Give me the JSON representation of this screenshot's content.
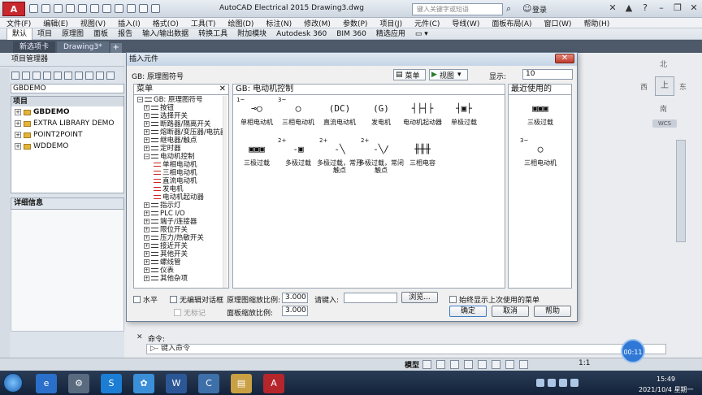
{
  "app": {
    "logo": "A",
    "title": "AutoCAD Electrical 2015    Drawing3.dwg",
    "search_placeholder": "键入关键字或短语",
    "login": "登录"
  },
  "menubar": [
    "文件(F)",
    "编辑(E)",
    "视图(V)",
    "插入(I)",
    "格式(O)",
    "工具(T)",
    "绘图(D)",
    "标注(N)",
    "修改(M)",
    "参数(P)",
    "项目(J)",
    "元件(C)",
    "导线(W)",
    "面板布局(A)",
    "窗口(W)",
    "帮助(H)"
  ],
  "ribbon_tabs": [
    "默认",
    "项目",
    "原理图",
    "面板",
    "报告",
    "输入/输出数据",
    "转换工具",
    "附加模块",
    "Autodesk 360",
    "BIM 360",
    "精选应用"
  ],
  "doc_tabs": [
    "新选项卡",
    "Drawing3*"
  ],
  "doc_tab_add": "+",
  "viewcube": {
    "n": "北",
    "w": "西",
    "top": "上",
    "e": "东",
    "s": "南",
    "wcs": "WCS"
  },
  "project_manager": {
    "title": "项目管理器",
    "active": "GBDEMO",
    "tree_head": "项目",
    "projects": [
      "GBDEMO",
      "EXTRA LIBRARY DEMO",
      "POINT2POINT",
      "WDDEMO"
    ],
    "details": "详细信息"
  },
  "command": {
    "label": "命令:",
    "prompt": "▷- 键入命令"
  },
  "status": {
    "model": "模型",
    "scale": "1:1",
    "timer": "00:11"
  },
  "taskbar": {
    "time": "15:49",
    "date": "2021/10/4 星期一"
  },
  "dialog": {
    "title": "插入元件",
    "gb_label": "GB: 原理图符号",
    "menu_btn": "菜单",
    "view_btn": "视图",
    "display_label": "显示:",
    "display_value": "10",
    "menu_pane_title": "菜单",
    "main_pane_title": "GB: 电动机控制",
    "recent_pane_title": "最近使用的",
    "tree": [
      {
        "label": "GB: 原理图符号",
        "level": 0,
        "sign": "−"
      },
      {
        "label": "按钮",
        "level": 1,
        "sign": "+"
      },
      {
        "label": "选择开关",
        "level": 1,
        "sign": "+"
      },
      {
        "label": "断路器/隔离开关",
        "level": 1,
        "sign": "+"
      },
      {
        "label": "熔断器/变压器/电抗器",
        "level": 1,
        "sign": "+"
      },
      {
        "label": "继电器/触点",
        "level": 1,
        "sign": "+"
      },
      {
        "label": "定时器",
        "level": 1,
        "sign": "+"
      },
      {
        "label": "电动机控制",
        "level": 1,
        "sign": "−"
      },
      {
        "label": "单相电动机",
        "level": 2,
        "sign": ""
      },
      {
        "label": "三相电动机",
        "level": 2,
        "sign": ""
      },
      {
        "label": "直流电动机",
        "level": 2,
        "sign": ""
      },
      {
        "label": "发电机",
        "level": 2,
        "sign": ""
      },
      {
        "label": "电动机起动器",
        "level": 2,
        "sign": ""
      },
      {
        "label": "指示灯",
        "level": 1,
        "sign": "+"
      },
      {
        "label": "PLC I/O",
        "level": 1,
        "sign": "+"
      },
      {
        "label": "端子/连接器",
        "level": 1,
        "sign": "+"
      },
      {
        "label": "限位开关",
        "level": 1,
        "sign": "+"
      },
      {
        "label": "压力/热敏开关",
        "level": 1,
        "sign": "+"
      },
      {
        "label": "接近开关",
        "level": 1,
        "sign": "+"
      },
      {
        "label": "其他开关",
        "level": 1,
        "sign": "+"
      },
      {
        "label": "螺线管",
        "level": 1,
        "sign": "+"
      },
      {
        "label": "仪表",
        "level": 1,
        "sign": "+"
      },
      {
        "label": "其他杂项",
        "level": 1,
        "sign": "+"
      }
    ],
    "symbols": [
      {
        "tag": "1~",
        "glyph": "⊸◯",
        "label": "单相电动机"
      },
      {
        "tag": "3~",
        "glyph": "◯",
        "label": "三相电动机"
      },
      {
        "tag": "",
        "glyph": "(DC)",
        "label": "直流电动机"
      },
      {
        "tag": "",
        "glyph": "(G)",
        "label": "发电机"
      },
      {
        "tag": "",
        "glyph": "┤├┤├",
        "label": "电动机起动器"
      },
      {
        "tag": "",
        "glyph": "┤▣├",
        "label": "单极过载"
      },
      {
        "tag": "",
        "glyph": "▣▣▣",
        "label": "三极过载"
      },
      {
        "tag": "2+",
        "glyph": "-▣",
        "label": "多极过载"
      },
      {
        "tag": "2+",
        "glyph": "-╲",
        "label": "多极过载，常开触点"
      },
      {
        "tag": "2+",
        "glyph": "-╲/",
        "label": "多极过载，常闭触点"
      },
      {
        "tag": "",
        "glyph": "╫╫╫",
        "label": "三相电容"
      }
    ],
    "recent": [
      {
        "tag": "",
        "glyph": "▣▣▣",
        "label": "三极过载"
      },
      {
        "tag": "3~",
        "glyph": "◯",
        "label": "三相电动机"
      }
    ],
    "horizontal": "水平",
    "no_edit": "无编辑对话框",
    "no_mark": "无标记",
    "sch_scale_label": "原理图缩放比例:",
    "sch_scale": "3.000",
    "panel_scale_label": "面板缩放比例:",
    "panel_scale": "3.000",
    "input_label": "请键入:",
    "browse": "浏览...",
    "always_show": "始终显示上次使用的菜单",
    "ok": "确定",
    "cancel": "取消",
    "help": "帮助"
  }
}
